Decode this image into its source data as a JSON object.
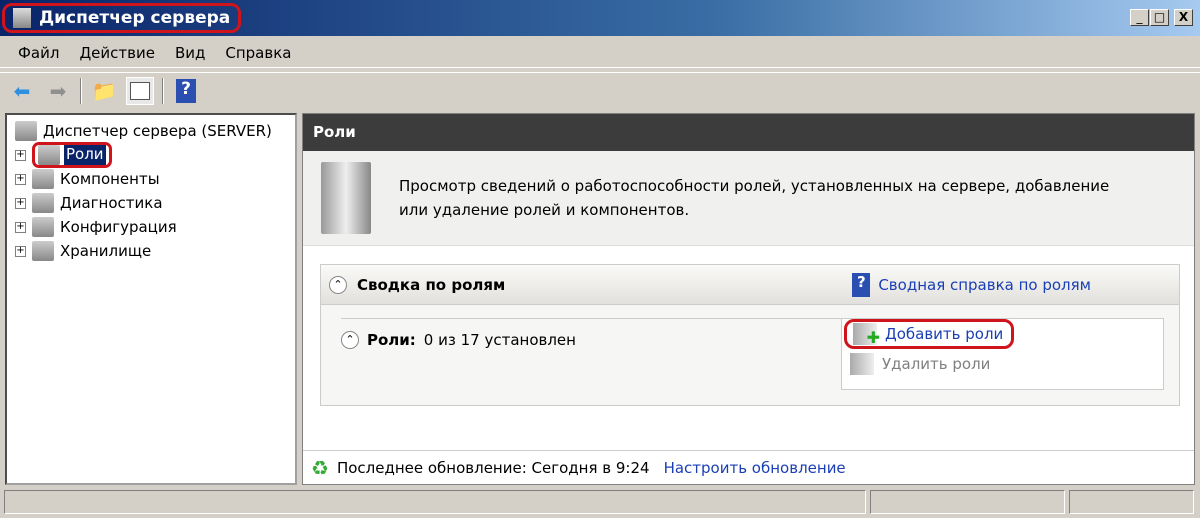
{
  "window": {
    "title": "Диспетчер сервера",
    "minimize": "_",
    "maximize": "□",
    "close": "X"
  },
  "menu": [
    "Файл",
    "Действие",
    "Вид",
    "Справка"
  ],
  "toolbar": {
    "back": "back-icon",
    "forward": "forward-icon",
    "up": "folder-up-icon",
    "show_hide": "console-tree-icon",
    "help": "?"
  },
  "tree": {
    "root": "Диспетчер сервера (SERVER)",
    "items": [
      "Роли",
      "Компоненты",
      "Диагностика",
      "Конфигурация",
      "Хранилище"
    ],
    "selected": "Роли"
  },
  "main": {
    "header": "Роли",
    "description": "Просмотр сведений о работоспособности ролей, установленных на сервере, добавление или удаление ролей и компонентов.",
    "summary": {
      "title": "Сводка по ролям",
      "help_link": "Сводная справка по ролям",
      "roles_label": "Роли:",
      "roles_value": "0 из 17 установлен",
      "add": "Добавить роли",
      "remove": "Удалить роли"
    },
    "footer": {
      "last_update": "Последнее обновление: Сегодня в 9:24",
      "configure": "Настроить обновление"
    }
  },
  "colors": {
    "highlight": "#d0141c",
    "link": "#1a3fb5",
    "header": "#3c3c3c"
  }
}
